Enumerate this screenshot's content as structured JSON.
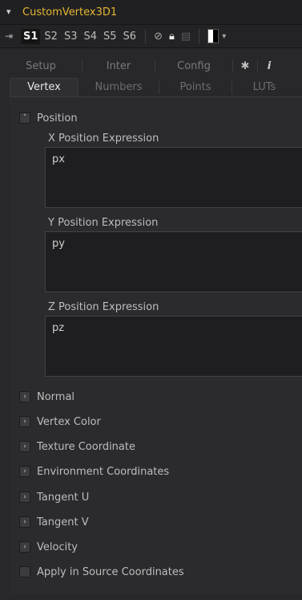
{
  "header": {
    "title": "CustomVertex3D1"
  },
  "toolbar": {
    "slots": [
      "S1",
      "S2",
      "S3",
      "S4",
      "S5",
      "S6"
    ],
    "active_slot": "S1"
  },
  "tabs_top": [
    "Setup",
    "Inter",
    "Config"
  ],
  "tabs_bottom": [
    "Vertex",
    "Numbers",
    "Points",
    "LUTs"
  ],
  "active_tab": "Vertex",
  "position": {
    "label": "Position",
    "fields": [
      {
        "label": "X Position Expression",
        "value": "px"
      },
      {
        "label": "Y Position Expression",
        "value": "py"
      },
      {
        "label": "Z Position Expression",
        "value": "pz"
      }
    ]
  },
  "sections": [
    "Normal",
    "Vertex Color",
    "Texture Coordinate",
    "Environment Coordinates",
    "Tangent U",
    "Tangent V",
    "Velocity"
  ],
  "apply_source": {
    "label": "Apply in Source Coordinates"
  },
  "colors": {
    "title": "#e6b632",
    "background": "#28282b",
    "field": "#1e1e20"
  }
}
